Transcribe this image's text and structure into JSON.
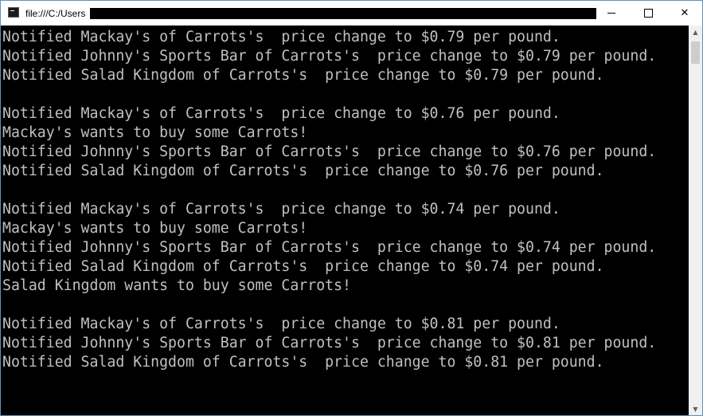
{
  "window": {
    "title": "file:///C:/Users",
    "controls": {
      "minimize_icon": "minimize-icon",
      "maximize_icon": "maximize-icon",
      "close_glyph": "✕"
    }
  },
  "console": {
    "lines": [
      "Notified Mackay's of Carrots's  price change to $0.79 per pound.",
      "Notified Johnny's Sports Bar of Carrots's  price change to $0.79 per pound.",
      "Notified Salad Kingdom of Carrots's  price change to $0.79 per pound.",
      "",
      "Notified Mackay's of Carrots's  price change to $0.76 per pound.",
      "Mackay's wants to buy some Carrots!",
      "Notified Johnny's Sports Bar of Carrots's  price change to $0.76 per pound.",
      "Notified Salad Kingdom of Carrots's  price change to $0.76 per pound.",
      "",
      "Notified Mackay's of Carrots's  price change to $0.74 per pound.",
      "Mackay's wants to buy some Carrots!",
      "Notified Johnny's Sports Bar of Carrots's  price change to $0.74 per pound.",
      "Notified Salad Kingdom of Carrots's  price change to $0.74 per pound.",
      "Salad Kingdom wants to buy some Carrots!",
      "",
      "Notified Mackay's of Carrots's  price change to $0.81 per pound.",
      "Notified Johnny's Sports Bar of Carrots's  price change to $0.81 per pound.",
      "Notified Salad Kingdom of Carrots's  price change to $0.81 per pound."
    ],
    "text_color": "#c0c0c0",
    "background_color": "#000000"
  },
  "scrollbar": {
    "up_glyph": "▲",
    "down_glyph": "▼"
  }
}
